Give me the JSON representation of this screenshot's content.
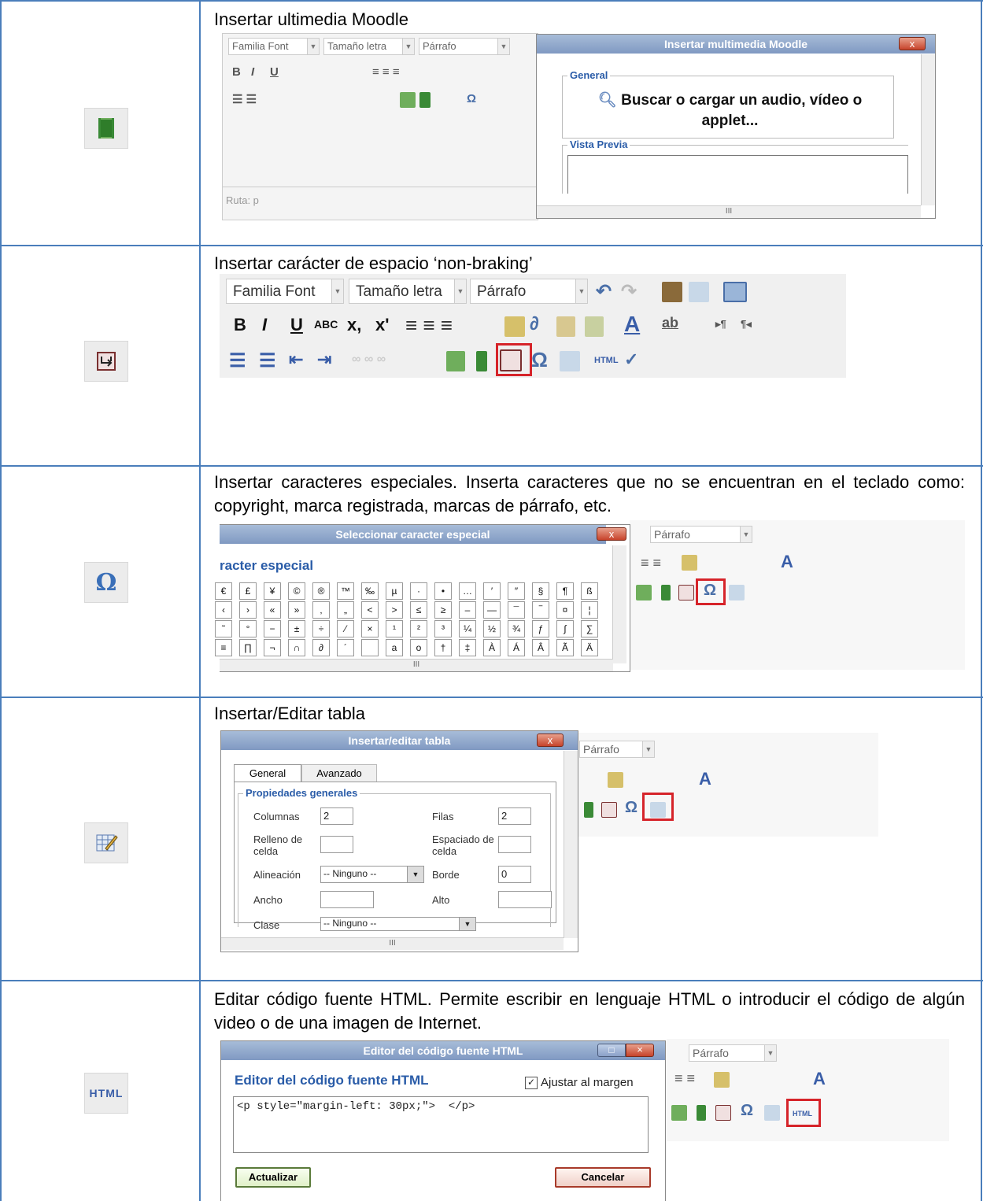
{
  "rows": [
    {
      "description": "Insertar   ultimedia  Moodle",
      "icon": "moodle-media-icon",
      "editor": {
        "font_family": "Familia Font",
        "font_size": "Tamaño letra",
        "format": "Párrafo",
        "path": "Ruta: p"
      },
      "dialog": {
        "title": "Insertar multimedia Moodle",
        "close": "x",
        "general_legend": "General",
        "search_link": "Buscar o cargar un audio, vídeo o applet...",
        "preview_legend": "Vista Previa",
        "hscroll_mark": "III"
      }
    },
    {
      "description": "Insertar carácter de espacio ‘non-braking’",
      "icon": "nonbreaking-icon",
      "editor": {
        "font_family": "Familia Font",
        "font_size": "Tamaño letra",
        "format": "Párrafo"
      }
    },
    {
      "description": "Insertar caracteres especiales. Inserta caracteres que no se encuentran en el teclado como: copyright, marca registrada, marcas de párrafo, etc.",
      "icon": "omega-icon",
      "editor": {
        "format": "Párrafo"
      },
      "dialog": {
        "title": "Seleccionar caracter especial",
        "close": "x",
        "heading": "racter especial",
        "grid": [
          [
            "€",
            "£",
            "¥",
            "©",
            "®",
            "™",
            "‰",
            "µ",
            "·",
            "•",
            "…",
            "′",
            "″",
            "§",
            "¶",
            "ß"
          ],
          [
            "‹",
            "›",
            "«",
            "»",
            "‚",
            "„",
            "<",
            ">",
            "≤",
            "≥",
            "–",
            "—",
            "¯",
            "‾",
            "¤",
            "¦"
          ],
          [
            "˜",
            "°",
            "−",
            "±",
            "÷",
            "⁄",
            "×",
            "¹",
            "²",
            "³",
            "¼",
            "½",
            "¾",
            "ƒ",
            "∫",
            "∑"
          ],
          [
            "≡",
            "∏",
            "¬",
            "∩",
            "∂",
            "´",
            "",
            "a",
            "o",
            "†",
            "‡",
            "À",
            "Á",
            "Â",
            "Ã",
            "Ä"
          ]
        ],
        "hscroll_mark": "III"
      }
    },
    {
      "description": "Insertar/Editar tabla",
      "icon": "table-edit-icon",
      "editor": {
        "format": "Párrafo"
      },
      "dialog": {
        "title": "Insertar/editar tabla",
        "close": "x",
        "tab_general": "General",
        "tab_advanced": "Avanzado",
        "legend": "Propiedades generales",
        "columns_label": "Columnas",
        "columns_value": "2",
        "rows_label": "Filas",
        "rows_value": "2",
        "padding_label": "Relleno de celda",
        "spacing_label": "Espaciado de celda",
        "align_label": "Alineación",
        "align_value": "-- Ninguno --",
        "border_label": "Borde",
        "border_value": "0",
        "width_label": "Ancho",
        "height_label": "Alto",
        "class_label": "Clase",
        "class_value": "-- Ninguno --",
        "hscroll_mark": "III"
      }
    },
    {
      "description": "Editar código fuente HTML. Permite escribir en lenguaje HTML o introducir el código de algún video o de una imagen de Internet.",
      "icon": "html-icon",
      "icon_text": "HTML",
      "editor": {
        "format": "Párrafo"
      },
      "dialog": {
        "title": "Editor del código fuente HTML",
        "heading": "Editor del código fuente HTML",
        "wrap_label": "Ajustar al margen",
        "code": "<p style=\"margin-left: 30px;\">  </p>",
        "update_button": "Actualizar",
        "cancel_button": "Cancelar"
      }
    }
  ]
}
